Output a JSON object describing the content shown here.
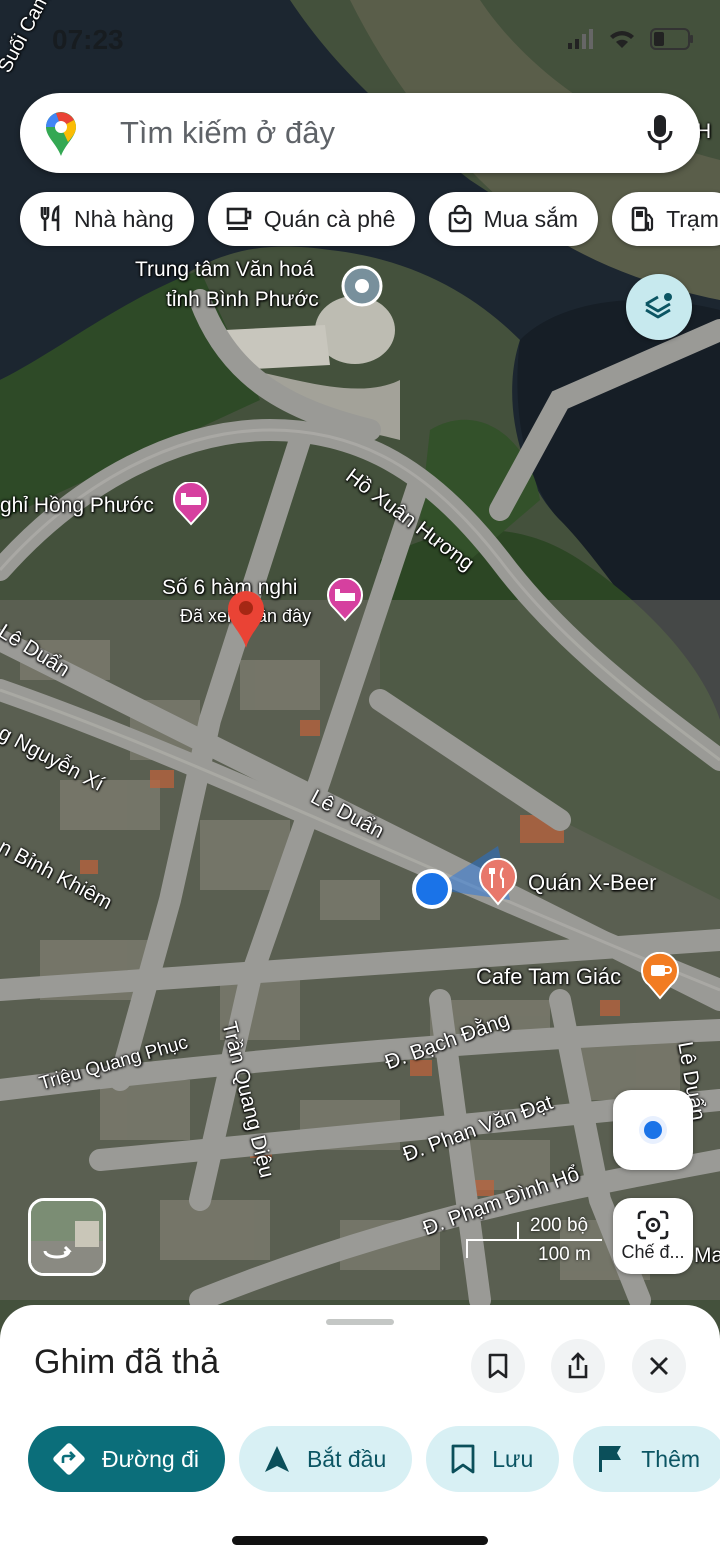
{
  "status_bar": {
    "time": "07:23"
  },
  "search": {
    "placeholder": "Tìm kiếm ở đây"
  },
  "chips": [
    {
      "label": "Nhà hàng",
      "icon": "restaurant-icon"
    },
    {
      "label": "Quán cà phê",
      "icon": "coffee-icon"
    },
    {
      "label": "Mua sắm",
      "icon": "shopping-bag-icon"
    },
    {
      "label": "Trạm",
      "icon": "gas-station-icon"
    }
  ],
  "map_labels": {
    "culture_center_1": "Trung tâm Văn hoá",
    "culture_center_2": "tỉnh Bình Phước",
    "suoi": "Suối Cam",
    "ho_xuan_huong": "Hồ Xuân Hương",
    "nha_nghi_hong_phuoc": "ghỉ Hồng Phước",
    "so6_1": "Số 6 hàm nghi",
    "so6_2": "Đã xem gần đây",
    "le_duan_1": "Lê Duẩn",
    "le_duan_2": "Lê Duẩn",
    "le_duan_3": "Lê Duẩn",
    "nguyen_xi": "g Nguyễn Xí",
    "binh_khiem": "n Bỉnh Khiêm",
    "quan_x_beer": "Quán X-Beer",
    "cafe_tam_giac": "Cafe Tam Giác",
    "bach_dang": "Đ. Bạch Đằng",
    "trieu_quang_phuc": "Triệu Quang Phục",
    "tran_quang_dieu": "Trần Quang Diệu",
    "phan_van_dat": "Đ. Phan Văn Đạt",
    "pham_dinh_ho": "Đ. Phạm Đình Hổ",
    "ma": "Ma",
    "h_edge": "H"
  },
  "scale": {
    "imperial": "200 bộ",
    "metric": "100 m"
  },
  "lens_button": {
    "label": "Chế đ..."
  },
  "sheet": {
    "title": "Ghim đã thả",
    "actions": [
      {
        "label": "Đường đi",
        "icon": "directions-icon"
      },
      {
        "label": "Bắt đầu",
        "icon": "navigation-arrow-icon"
      },
      {
        "label": "Lưu",
        "icon": "bookmark-icon"
      },
      {
        "label": "Thêm",
        "icon": "flag-icon"
      }
    ]
  },
  "colors": {
    "primary": "#0b6e7a",
    "secondary_bg": "#d8f0f4",
    "pin": "#ea4335",
    "location": "#1a73e8"
  }
}
